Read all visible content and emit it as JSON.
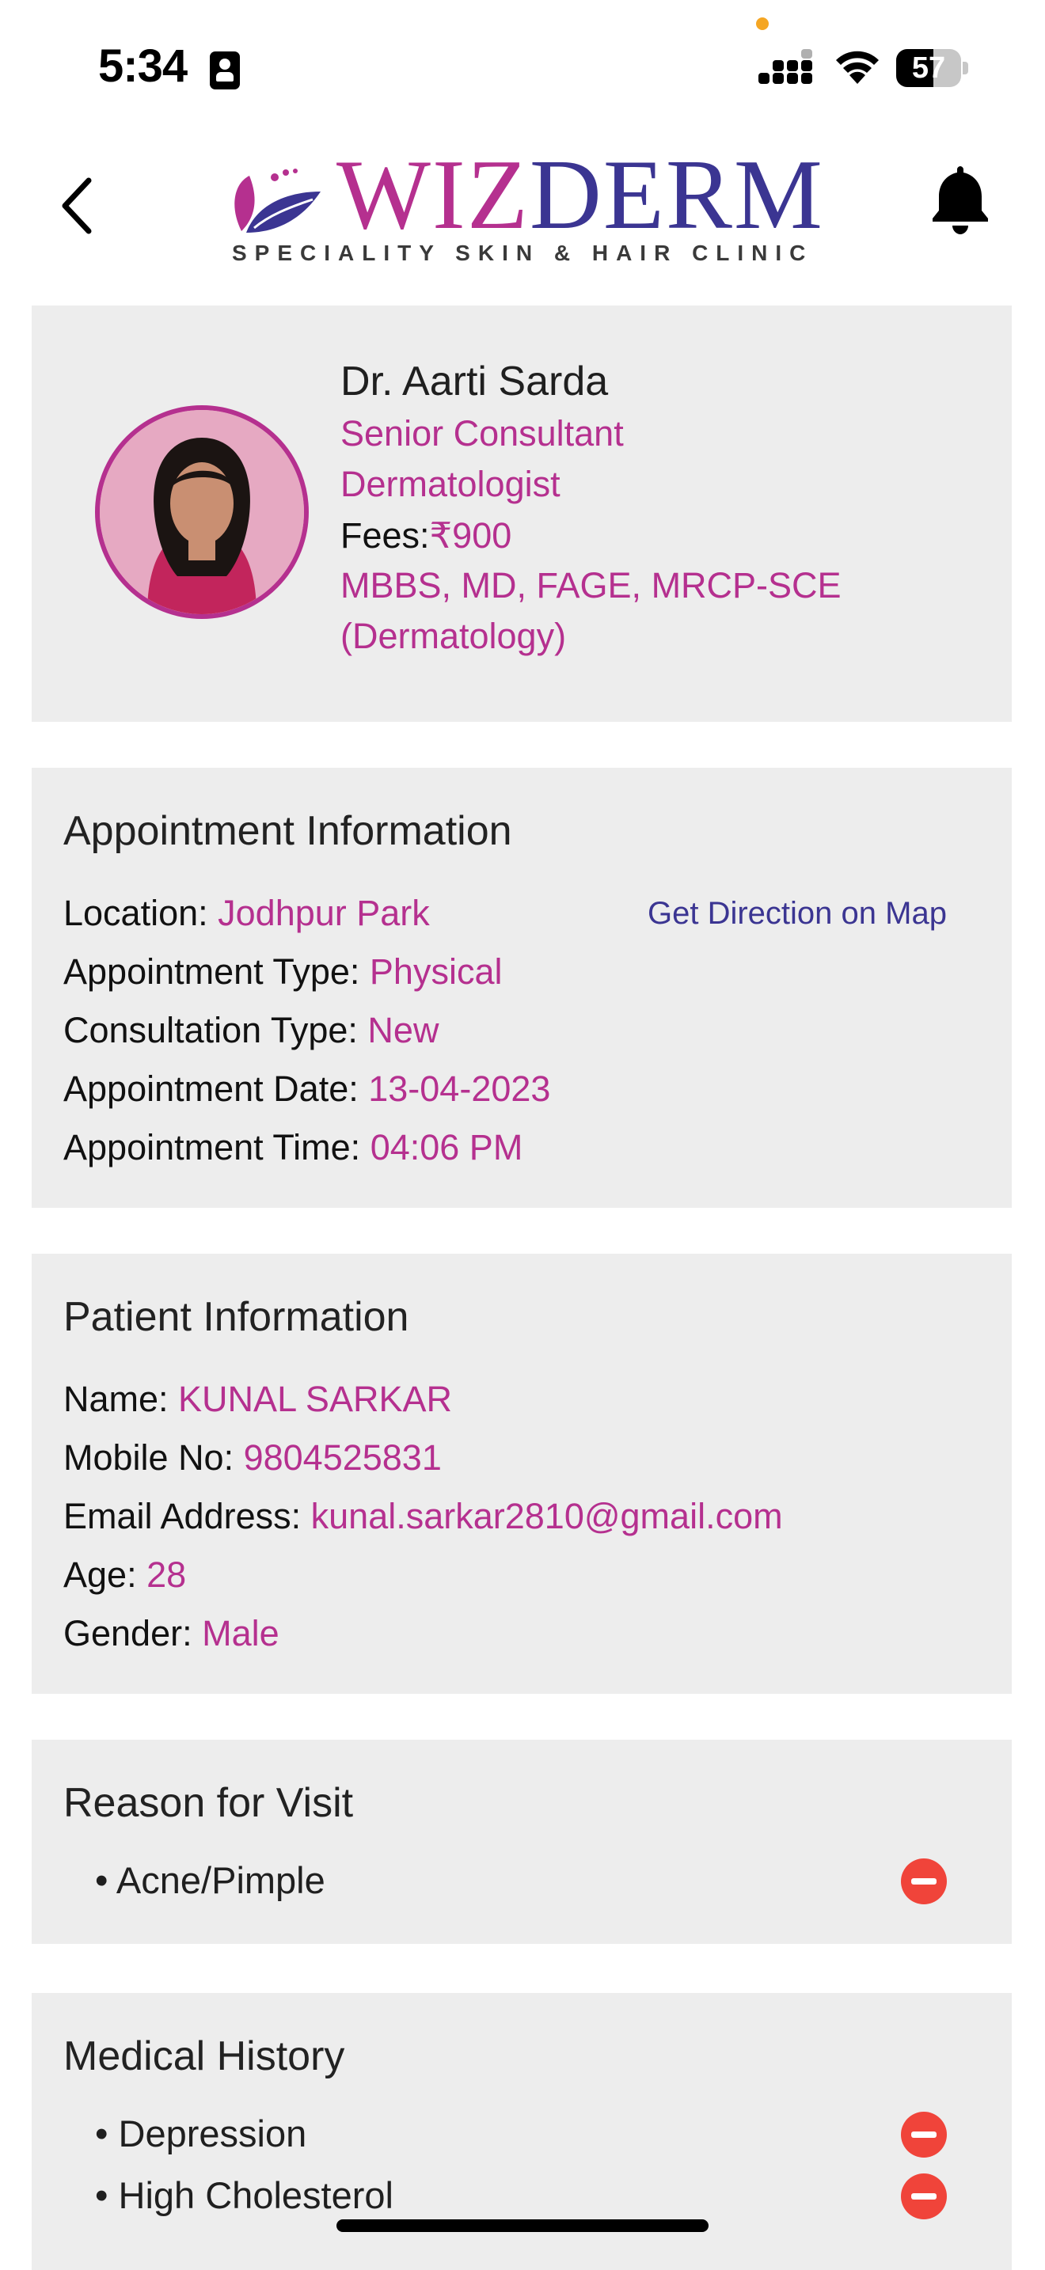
{
  "status_bar": {
    "time": "5:34",
    "battery_level": "57",
    "battery_fraction": 0.57,
    "icons": [
      "contact-card-icon",
      "signal-icon",
      "wifi-icon",
      "battery-icon"
    ]
  },
  "header": {
    "logo_text_wiz": "WIZ",
    "logo_text_derm": "DERM",
    "logo_tagline": "SPECIALITY SKIN & HAIR CLINIC",
    "back_icon": "chevron-left-icon",
    "bell_icon": "bell-icon"
  },
  "doctor": {
    "name": "Dr. Aarti Sarda",
    "title_line1": "Senior Consultant",
    "title_line2": "Dermatologist",
    "fees_label": "Fees:",
    "fees_value": "₹900",
    "qualification_line1": "MBBS, MD, FAGE, MRCP-SCE",
    "qualification_line2": "(Dermatology)"
  },
  "appointment": {
    "title": "Appointment Information",
    "location_label": "Location: ",
    "location_value": "Jodhpur Park",
    "direction_link": "Get Direction on Map",
    "type_label": "Appointment Type: ",
    "type_value": "Physical",
    "consultation_label": "Consultation Type: ",
    "consultation_value": "New",
    "date_label": "Appointment Date: ",
    "date_value": "13-04-2023",
    "time_label": "Appointment Time: ",
    "time_value": "04:06 PM"
  },
  "patient": {
    "title": "Patient Information",
    "name_label": "Name: ",
    "name_value": "KUNAL SARKAR",
    "mobile_label": "Mobile No: ",
    "mobile_value": "9804525831",
    "email_label": "Email Address: ",
    "email_value": "kunal.sarkar2810@gmail.com",
    "age_label": "Age: ",
    "age_value": "28",
    "gender_label": "Gender: ",
    "gender_value": "Male"
  },
  "reason": {
    "title": "Reason for Visit",
    "items": [
      "• Acne/Pimple"
    ]
  },
  "medical_history": {
    "title": "Medical History",
    "items": [
      "• Depression",
      "• High Cholesterol"
    ]
  },
  "colors": {
    "accent": "#b5308f",
    "brand_blue": "#3b3592",
    "card_bg": "#ededed",
    "remove_red": "#f0443a"
  }
}
